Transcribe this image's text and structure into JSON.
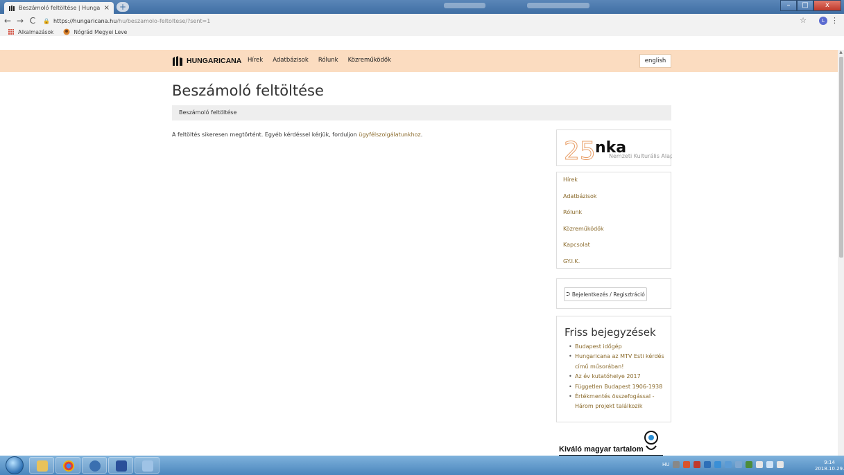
{
  "browser": {
    "tab_title": "Beszámoló feltöltése | Hungarica",
    "tab_close": "×",
    "new_tab": "+",
    "back": "←",
    "forward": "→",
    "reload": "C",
    "url_host": "https://hungaricana.hu",
    "url_path": "/hu/beszamolo-feltoltese/?sent=1",
    "star": "☆",
    "profile_initial": "L",
    "menu": "⋮",
    "bookmarks": [
      {
        "label": "Alkalmazások"
      },
      {
        "label": "Nógrád Megyei Leve"
      }
    ],
    "window_controls": {
      "minimize": "–",
      "maximize": "□",
      "close": "x"
    }
  },
  "site": {
    "logo_text": "HUNGARICANA",
    "nav": [
      "Hírek",
      "Adatbázisok",
      "Rólunk",
      "Közreműködők"
    ],
    "language_button": "english"
  },
  "page": {
    "title": "Beszámoló feltöltése",
    "breadcrumb": "Beszámoló feltöltése",
    "message_text": "A feltöltés sikeresen megtörtént. Egyéb kérdéssel kérjük, forduljon ",
    "message_link": "ügyfélszolgálatunkhoz",
    "message_end": "."
  },
  "sidebar": {
    "nka_logo": {
      "number": "25",
      "brand": "nka",
      "tagline": "Nemzeti Kulturális Alap",
      "color": "#e8a06a"
    },
    "links": [
      "Hírek",
      "Adatbázisok",
      "Rólunk",
      "Közreműködők",
      "Kapcsolat",
      "GY.I.K."
    ],
    "login_icon": "⮊",
    "login_label": "Bejelentkezés / Regisztráció",
    "posts_title": "Friss bejegyzések",
    "posts": [
      "Budapest időgép",
      "Hungaricana az MTV Esti kérdés című műsorában!",
      "Az év kutatóhelye 2017",
      "Független Budapest 1906-1938",
      "Értékmentés összefogással - Három projekt találkozik"
    ],
    "badge_text": "Kiváló magyar tartalom"
  },
  "taskbar": {
    "language": "HU",
    "time": "9:14",
    "date": "2018.10.29."
  },
  "colors": {
    "header_bg": "#fbdcc0",
    "link": "#8a6a2b",
    "breadcrumb_bg": "#eeeeee"
  }
}
